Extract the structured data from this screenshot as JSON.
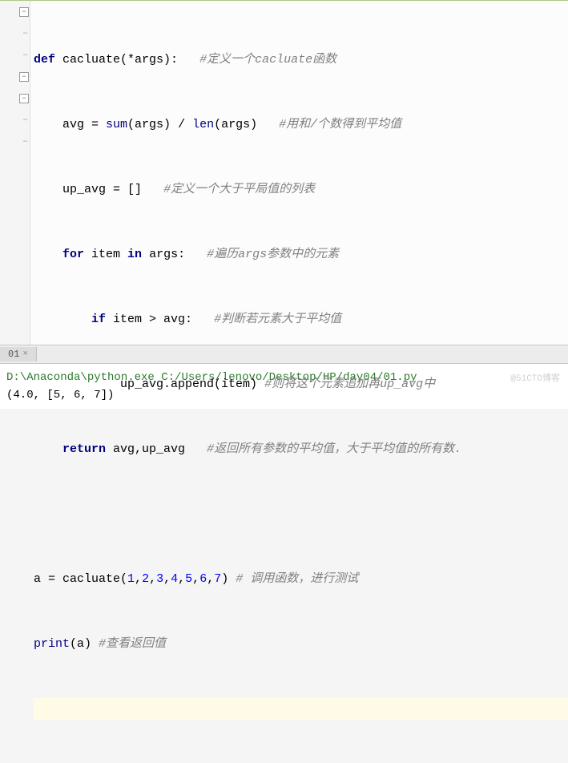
{
  "tabs": {
    "active": "01",
    "close_glyph": "×"
  },
  "code": {
    "l1": {
      "kw1": "def",
      "fn": "cacluate",
      "sig": "(*args):",
      "c": "#定义一个cacluate函数"
    },
    "l2": {
      "a": "avg = ",
      "b1": "sum",
      "p1": "(args)",
      "op": " / ",
      "b2": "len",
      "p2": "(args)",
      "c": "#用和/个数得到平均值"
    },
    "l3": {
      "a": "up_avg = []",
      "c": "#定义一个大于平局值的列表"
    },
    "l4": {
      "kw1": "for",
      "v": " item ",
      "kw2": "in",
      "p": " args:",
      "c": "#遍历args参数中的元素"
    },
    "l5": {
      "kw": "if",
      "cond": " item > avg:",
      "c": "#判断若元素大于平均值"
    },
    "l6": {
      "call": "up_avg.append(item)",
      "c": "#则将这个元素追加再up_avg中"
    },
    "l7": {
      "kw": "return",
      "ret": " avg,up_avg",
      "c": "#返回所有参数的平均值，大于平均值的所有数."
    },
    "l9": {
      "a": "a = cacluate(",
      "n1": "1",
      "n2": "2",
      "n3": "3",
      "n4": "4",
      "n5": "5",
      "n6": "6",
      "n7": "7",
      "b": ")",
      "c": "# 调用函数，进行测试"
    },
    "l10": {
      "fn": "print",
      "arg": "(a)",
      "c": "#查看返回值"
    }
  },
  "console": {
    "exe": "D:\\Anaconda\\python.exe",
    "file": "C:/Users/lenovo/Desktop/HP/day04/01.py",
    "output": "(4.0, [5, 6, 7])"
  },
  "watermark": "@51CTO博客"
}
